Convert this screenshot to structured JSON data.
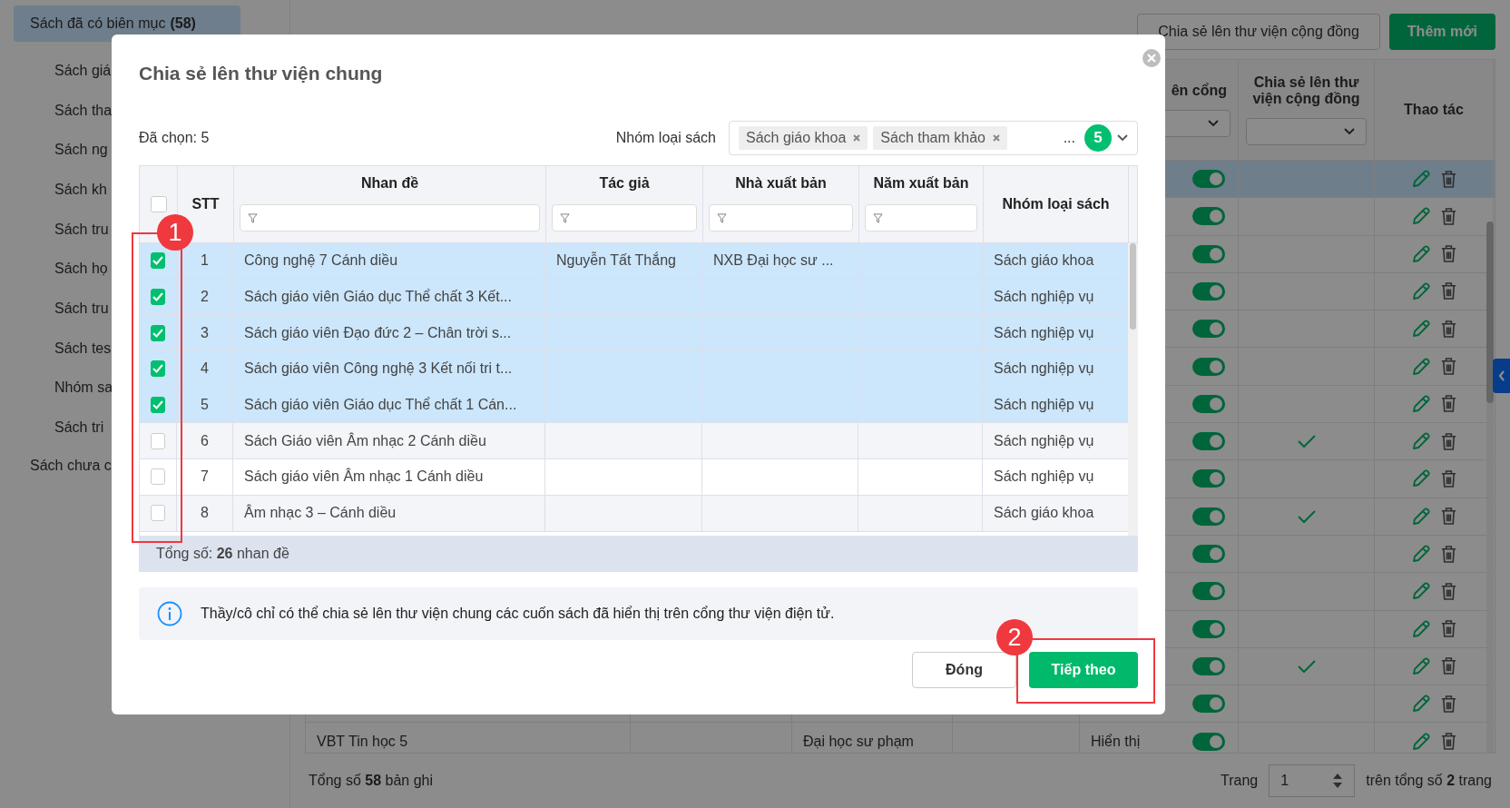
{
  "sidebar": {
    "items": [
      {
        "label": "Sách đã có biên mục",
        "count": "(58)",
        "selected": true,
        "children": [
          {
            "label": "Sách giá",
            "selected": false
          },
          {
            "label": "Sách tha",
            "selected": false
          },
          {
            "label": "Sách ng",
            "selected": false
          },
          {
            "label": "Sách kh",
            "selected": false
          },
          {
            "label": "Sách tru",
            "selected": false
          },
          {
            "label": "Sách họ",
            "selected": false
          },
          {
            "label": "Sách tru",
            "selected": false
          },
          {
            "label": "Sách tes",
            "selected": false
          },
          {
            "label": "Nhóm sa",
            "selected": false
          },
          {
            "label": "Sách tri",
            "selected": false
          }
        ]
      },
      {
        "label": "Sách chưa c",
        "selected": false
      }
    ]
  },
  "toolbar": {
    "buttons": [
      {
        "label": "Chia sẻ lên thư viện cộng đồng",
        "kind": "outline"
      },
      {
        "label": "Thêm mới",
        "kind": "primary"
      }
    ]
  },
  "table": {
    "columns": [
      {
        "label": "ên cổng",
        "kind": "select"
      },
      {
        "label": "Chia sẻ lên thư viện cộng đồng",
        "kind": "select"
      },
      {
        "label": "Thao tác",
        "kind": "plain"
      }
    ],
    "rows": [
      {
        "portal_on": true,
        "shared": false,
        "selected": true
      },
      {
        "portal_on": true,
        "shared": false,
        "selected": false
      },
      {
        "portal_on": true,
        "shared": false,
        "selected": false
      },
      {
        "portal_on": true,
        "shared": false,
        "selected": false
      },
      {
        "portal_on": true,
        "shared": false,
        "selected": false
      },
      {
        "portal_on": true,
        "shared": false,
        "selected": false
      },
      {
        "portal_on": true,
        "shared": false,
        "selected": false
      },
      {
        "portal_on": true,
        "shared": true,
        "selected": false
      },
      {
        "portal_on": true,
        "shared": false,
        "selected": false
      },
      {
        "portal_on": true,
        "shared": true,
        "selected": false
      },
      {
        "portal_on": true,
        "shared": false,
        "selected": false
      },
      {
        "portal_on": true,
        "shared": false,
        "selected": false
      },
      {
        "portal_on": true,
        "shared": false,
        "selected": false
      },
      {
        "portal_on": true,
        "shared": true,
        "selected": false
      },
      {
        "portal_on": true,
        "shared": false,
        "selected": false
      },
      {
        "title": "VBT Tin học 5",
        "publisher": "Đại học sư phạm",
        "status": "Hiển thị",
        "portal_on": true,
        "shared": false,
        "selected": false
      }
    ]
  },
  "footer": {
    "total": "Tổng số **58** bản ghi",
    "page_label": "Trang",
    "page_value": "1",
    "page_total": "trên tổng số **2** trang"
  },
  "modal": {
    "title": "Chia sẻ lên thư viện chung",
    "selected_count": "Đã chọn: 5",
    "filter": {
      "label": "Nhóm loại sách",
      "tags": [
        "Sách giáo khoa",
        "Sách tham khảo"
      ],
      "more": "...",
      "count": "5"
    },
    "header_checkbox": {
      "checked": false
    },
    "columns": [
      {
        "label": "STT",
        "kind": "plain"
      },
      {
        "label": "Nhan đề",
        "kind": "filter"
      },
      {
        "label": "Tác giả",
        "kind": "filter"
      },
      {
        "label": "Nhà xuất bản",
        "kind": "filter"
      },
      {
        "label": "Năm xuất bản",
        "kind": "filter"
      },
      {
        "label": "Nhóm loại sách",
        "kind": "plain"
      }
    ],
    "rows": [
      {
        "stt": "1",
        "title": "Công nghệ 7 Cánh diều",
        "author": "Nguyễn Tất Thắng",
        "publisher": "NXB Đại học sư ...",
        "group": "Sách giáo khoa",
        "checked": true
      },
      {
        "stt": "2",
        "title": "Sách giáo viên Giáo dục Thể chất 3 Kết...",
        "group": "Sách nghiệp vụ",
        "checked": true
      },
      {
        "stt": "3",
        "title": "Sách giáo viên Đạo đức 2 – Chân trời s...",
        "group": "Sách nghiệp vụ",
        "checked": true
      },
      {
        "stt": "4",
        "title": "Sách giáo viên Công nghệ 3 Kết nối tri t...",
        "group": "Sách nghiệp vụ",
        "checked": true
      },
      {
        "stt": "5",
        "title": "Sách giáo viên Giáo dục Thể chất 1 Cán...",
        "group": "Sách nghiệp vụ",
        "checked": true
      },
      {
        "stt": "6",
        "title": "Sách Giáo viên Âm nhạc 2 Cánh diều",
        "group": "Sách nghiệp vụ",
        "checked": false
      },
      {
        "stt": "7",
        "title": "Sách giáo viên Âm nhạc 1 Cánh diều",
        "group": "Sách nghiệp vụ",
        "checked": false
      },
      {
        "stt": "8",
        "title": "Âm nhạc 3 – Cánh diều",
        "group": "Sách giáo khoa",
        "checked": false
      }
    ],
    "total": "Tổng số: **26** nhan đề",
    "info": "Thầy/cô chỉ có thể chia sẻ lên thư viện chung các cuốn sách đã hiển thị trên cổng thư viện điện tử.",
    "buttons": [
      {
        "label": "Đóng",
        "kind": "secondary"
      },
      {
        "label": "Tiếp theo",
        "kind": "primary"
      }
    ]
  },
  "annotations": [
    {
      "label": "1"
    },
    {
      "label": "2"
    }
  ]
}
